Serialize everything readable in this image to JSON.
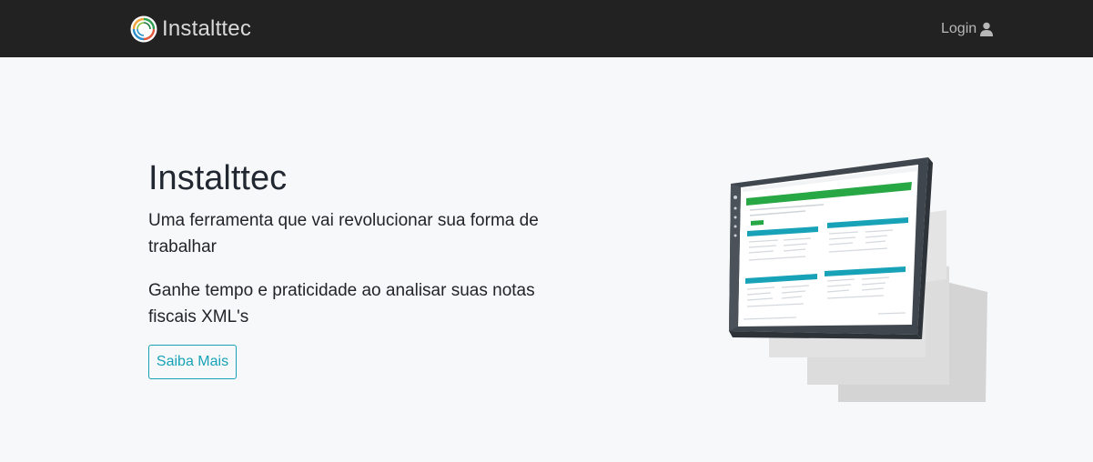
{
  "navbar": {
    "brand_name": "Instalttec",
    "login_label": "Login"
  },
  "hero": {
    "title": "Instalttec",
    "lead_1": "Uma ferramenta que vai revolucionar sua forma de trabalhar",
    "lead_2": "Ganhe tempo e praticidade ao analisar suas notas fiscais XML's",
    "cta_label": "Saiba Mais"
  },
  "colors": {
    "navbar_bg": "#222222",
    "page_bg": "#f7f8f9",
    "accent": "#17a2b8",
    "success": "#28a745"
  },
  "icons": [
    "circular-logo-icon",
    "user-icon"
  ]
}
